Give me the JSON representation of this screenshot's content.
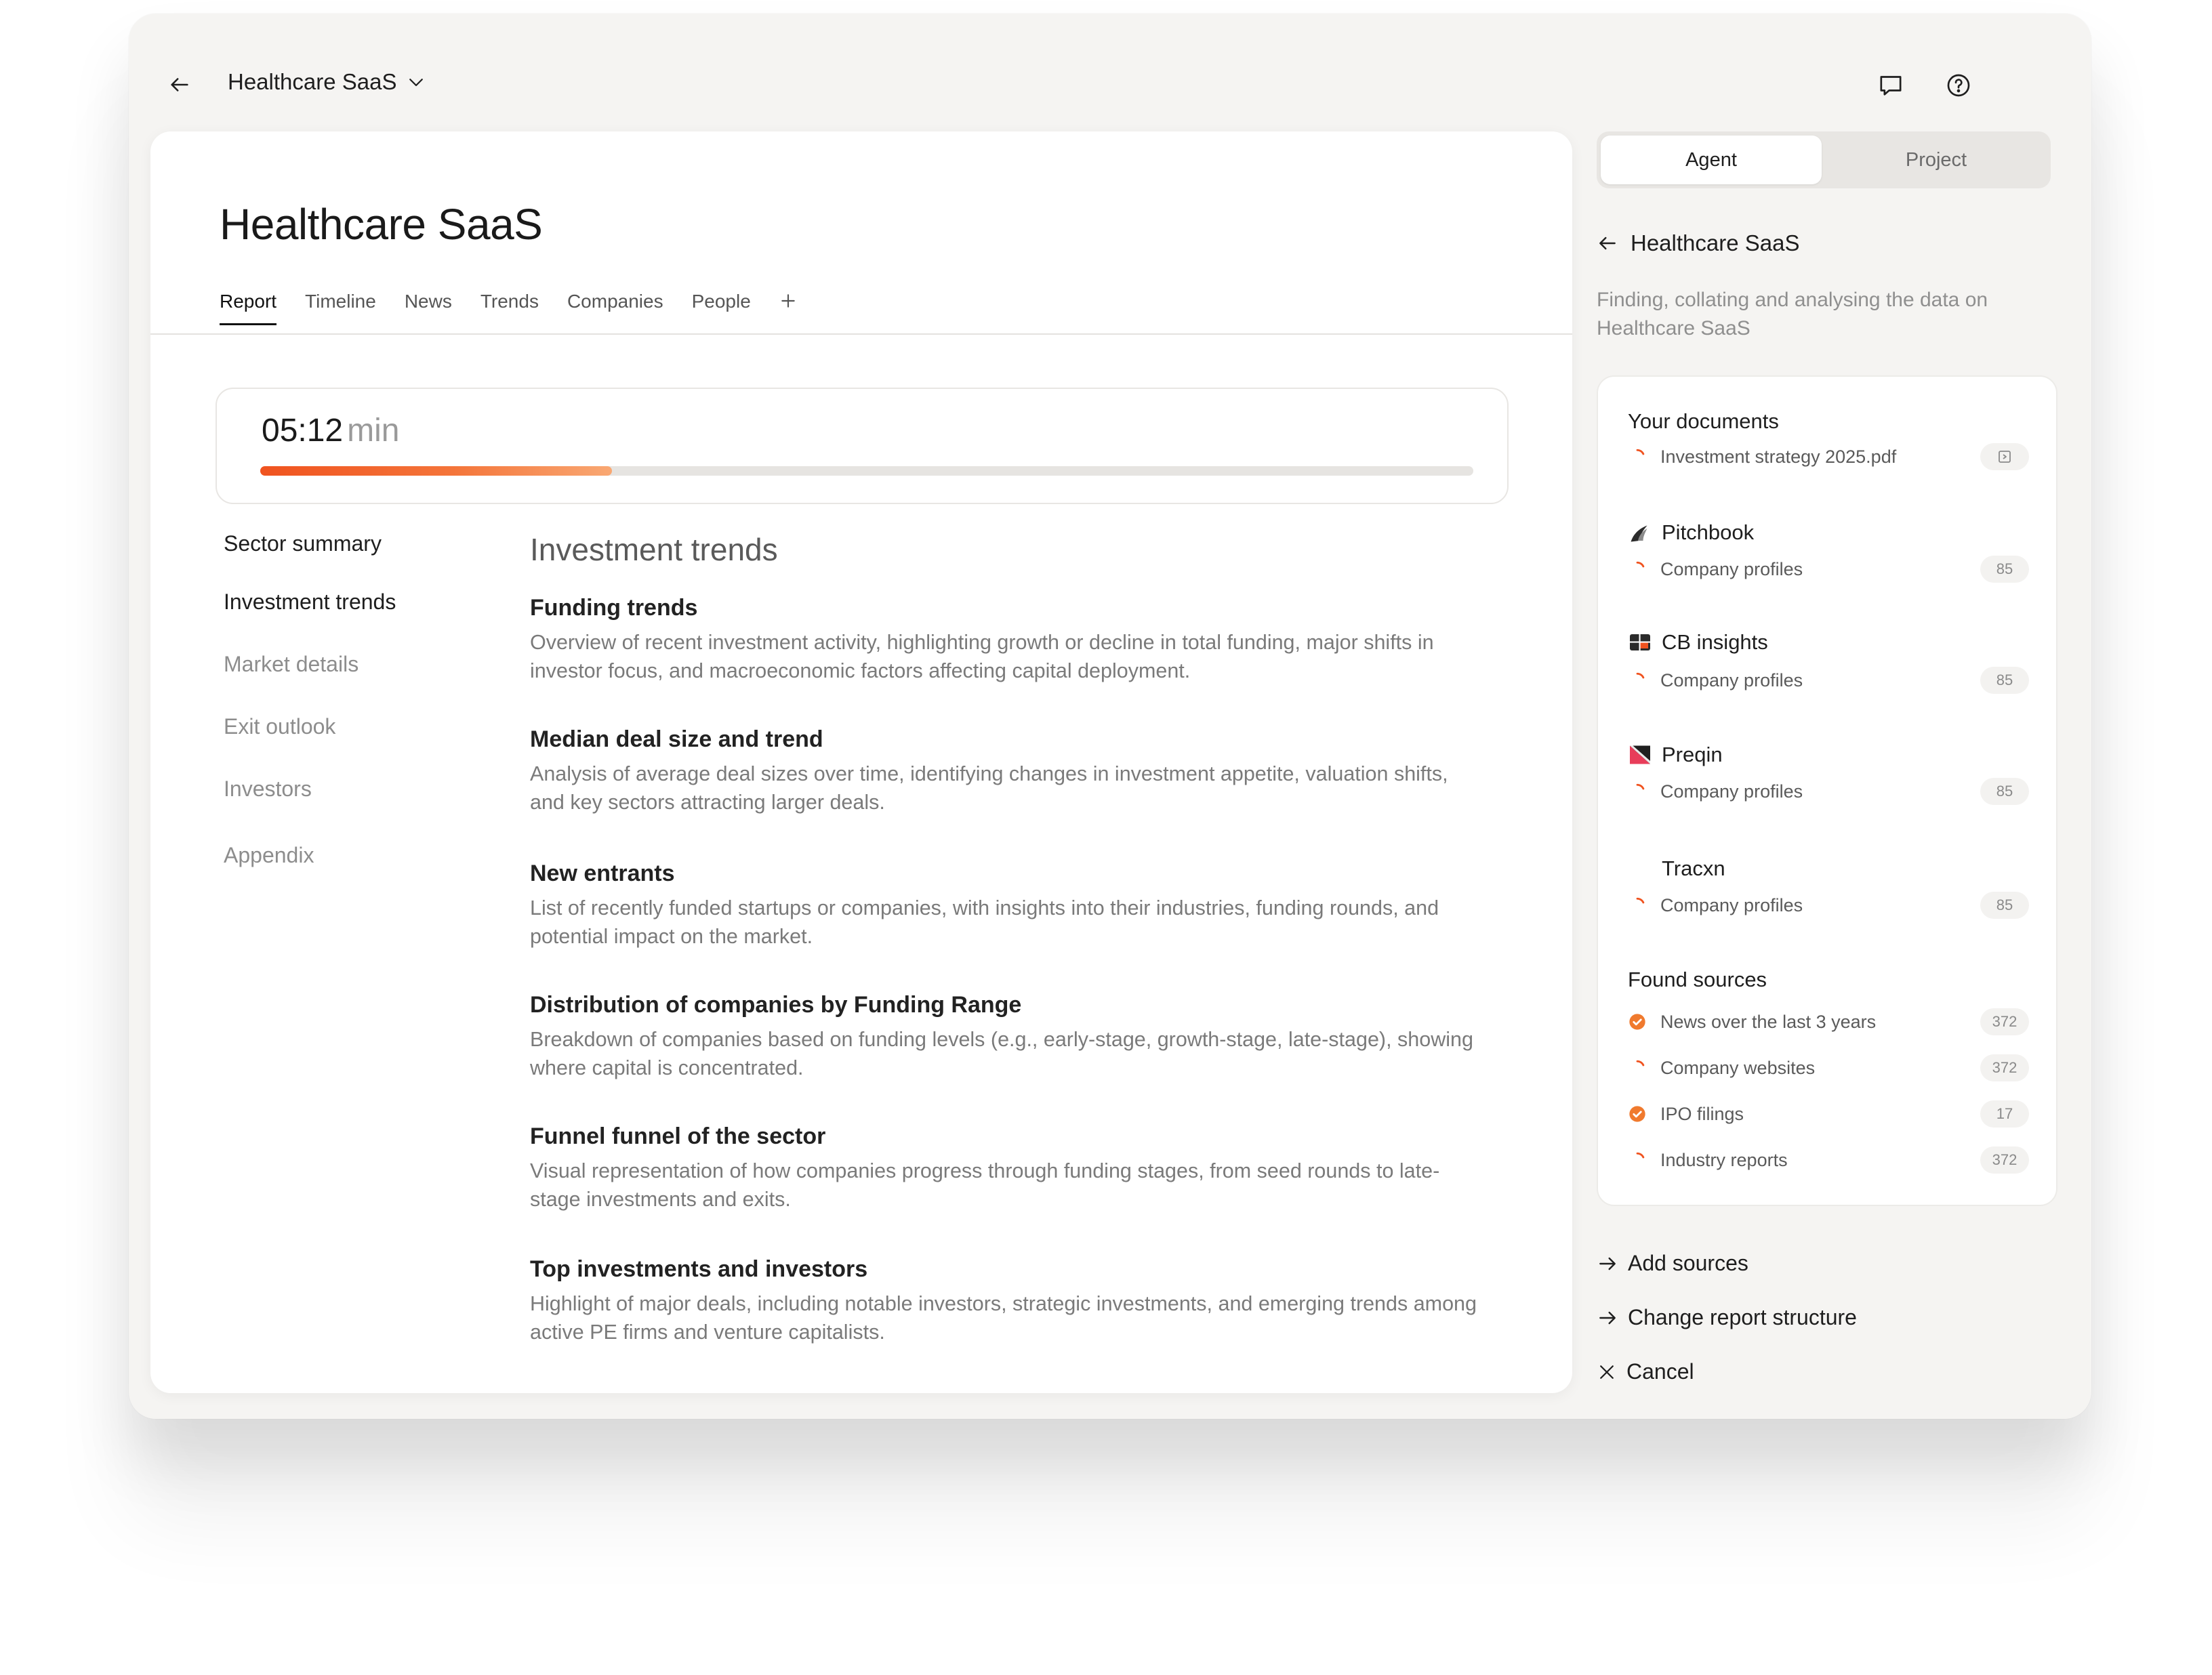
{
  "header": {
    "project": "Healthcare SaaS"
  },
  "report": {
    "title": "Healthcare SaaS",
    "tabs": [
      "Report",
      "Timeline",
      "News",
      "Trends",
      "Companies",
      "People"
    ],
    "active_tab": "Report",
    "timer": {
      "time": "05:12",
      "unit": "min",
      "progress_fraction": 0.29
    },
    "toc": [
      "Sector summary",
      "Investment trends",
      "Market details",
      "Exit outlook",
      "Investors",
      "Appendix"
    ],
    "content_title": "Investment trends",
    "sections": [
      {
        "title": "Funding trends",
        "text": "Overview of recent investment activity, highlighting growth or decline in total funding, major shifts in investor focus, and macroeconomic factors affecting capital deployment."
      },
      {
        "title": "Median deal size and trend",
        "text": "Analysis of average deal sizes over time, identifying changes in investment appetite, valuation shifts, and key sectors attracting larger deals."
      },
      {
        "title": "New entrants",
        "text": "List of recently funded startups or companies, with insights into their industries, funding rounds, and potential impact on the market."
      },
      {
        "title": "Distribution of companies by Funding Range",
        "text": "Breakdown of companies based on funding levels (e.g., early-stage, growth-stage, late-stage), showing where capital is concentrated."
      },
      {
        "title": "Funnel funnel of the sector",
        "text": "Visual representation of how companies progress through funding stages, from seed rounds to late-stage investments and exits."
      },
      {
        "title": "Top investments and investors",
        "text": "Highlight of major deals, including notable investors, strategic investments, and emerging trends among active PE firms and venture capitalists."
      }
    ]
  },
  "sidebar": {
    "tabs": [
      "Agent",
      "Project"
    ],
    "back_title": "Healthcare SaaS",
    "description": "Finding, collating and analysing the data on Healthcare SaaS",
    "your_documents": {
      "title": "Your documents",
      "file": "Investment strategy 2025.pdf"
    },
    "providers": [
      {
        "name": "Pitchbook",
        "item": "Company profiles",
        "count": "85",
        "icon": "pitchbook-logo"
      },
      {
        "name": "CB insights",
        "item": "Company profiles",
        "count": "85",
        "icon": "cbinsights-logo"
      },
      {
        "name": "Preqin",
        "item": "Company profiles",
        "count": "85",
        "icon": "preqin-logo"
      },
      {
        "name": "Tracxn",
        "item": "Company profiles",
        "count": "85",
        "icon": ""
      }
    ],
    "found_sources": {
      "title": "Found sources",
      "items": [
        {
          "label": "News over the last 3 years",
          "count": "372",
          "status": "done"
        },
        {
          "label": "Company websites",
          "count": "372",
          "status": "loading"
        },
        {
          "label": "IPO filings",
          "count": "17",
          "status": "done"
        },
        {
          "label": "Industry reports",
          "count": "372",
          "status": "loading"
        }
      ]
    },
    "actions": [
      "Add sources",
      "Change report structure",
      "Cancel"
    ]
  },
  "colors": {
    "accent": "#f0531f",
    "background": "#f5f4f2",
    "card": "#ffffff"
  }
}
